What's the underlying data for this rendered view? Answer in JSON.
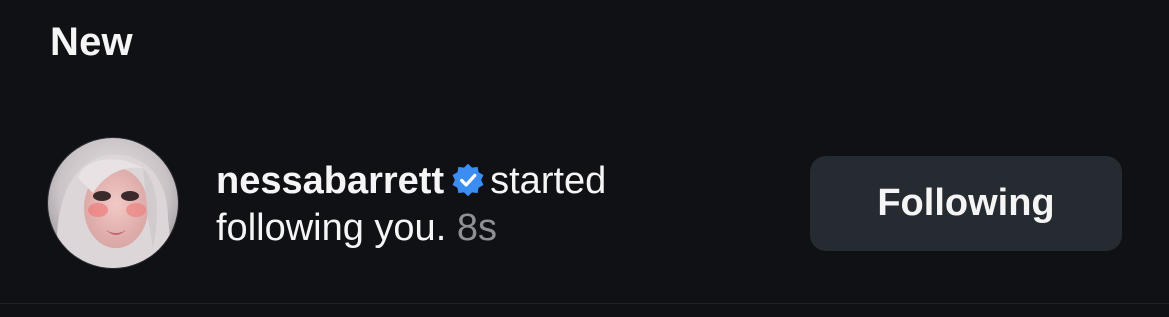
{
  "section": {
    "title": "New"
  },
  "notification": {
    "username": "nessabarrett",
    "action": "started following you.",
    "time": "8s",
    "verified_icon": "verified-badge-icon",
    "avatar_icon": "profile-avatar"
  },
  "follow_button": {
    "label": "Following"
  },
  "colors": {
    "background": "#0f1115",
    "button_bg": "#262a31",
    "verified_blue": "#3b8df1",
    "muted_text": "#8e9096"
  }
}
